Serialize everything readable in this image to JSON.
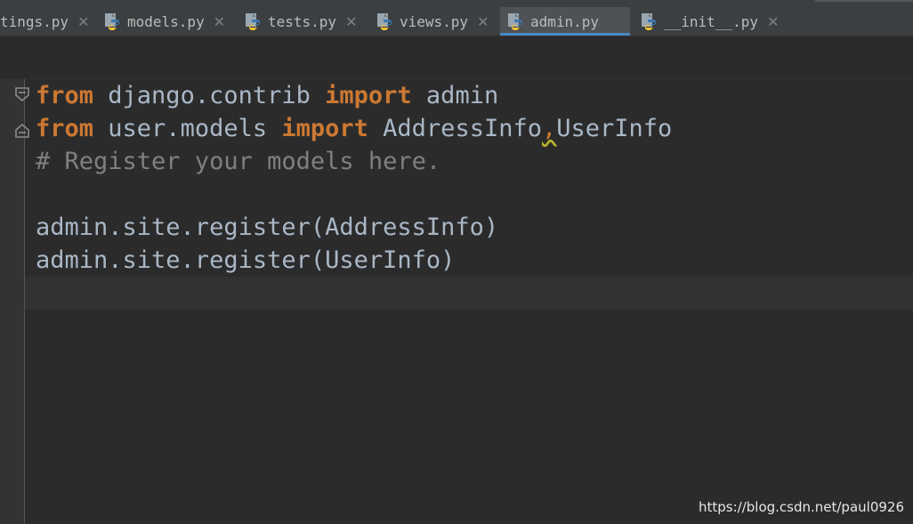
{
  "tabs": [
    {
      "label": "tings.py",
      "active": false
    },
    {
      "label": "models.py",
      "active": false
    },
    {
      "label": "tests.py",
      "active": false
    },
    {
      "label": "views.py",
      "active": false
    },
    {
      "label": "admin.py",
      "active": true
    },
    {
      "label": "__init__.py",
      "active": false
    }
  ],
  "tab_close_glyph": "✕",
  "code": {
    "line1": {
      "kw1": "from",
      "mod": " django.contrib ",
      "kw2": "import",
      "name": " admin"
    },
    "line2": {
      "kw1": "from",
      "mod": " user.models ",
      "kw2": "import",
      "name1": " AddressInfo",
      "comma": ",",
      "name2": "UserInfo"
    },
    "line3": {
      "comment": "# Register your models here."
    },
    "line4": {
      "text": ""
    },
    "line5": {
      "text": "admin.site.register(AddressInfo)"
    },
    "line6": {
      "text": "admin.site.register(UserInfo)"
    }
  },
  "watermark": "https://blog.csdn.net/paul0926",
  "colors": {
    "keyword": "#cc7832",
    "comment": "#808080",
    "default_text": "#a9b7c6",
    "active_tab_underline": "#4a88c7",
    "background": "#2b2b2b"
  },
  "icons": {
    "tab_icon": "python-file-icon",
    "fold_icon": "fold-marker-icon"
  }
}
